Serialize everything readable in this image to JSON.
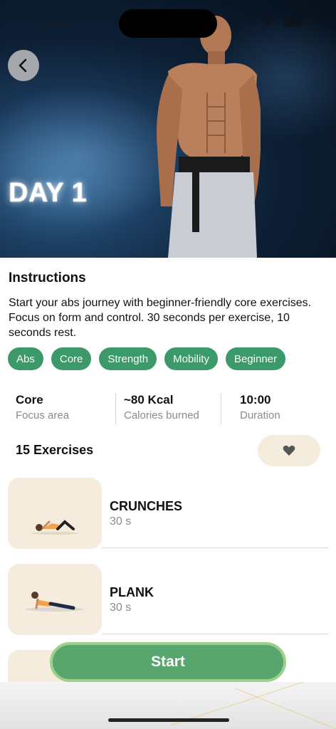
{
  "status_bar": {
    "time": "11:40"
  },
  "hero": {
    "title": "DAY 1"
  },
  "instructions": {
    "title": "Instructions",
    "text": "Start your abs journey with beginner-friendly core exercises. Focus on form and control. 30 seconds per exercise, 10 seconds rest."
  },
  "tags": [
    "Abs",
    "Core",
    "Strength",
    "Mobility",
    "Beginner"
  ],
  "stats": [
    {
      "value": "Core",
      "label": "Focus area"
    },
    {
      "value": "~80 Kcal",
      "label": "Calories burned"
    },
    {
      "value": "10:00",
      "label": "Duration"
    }
  ],
  "exercise_count": "15 Exercises",
  "exercises": [
    {
      "name": "CRUNCHES",
      "duration": "30 s"
    },
    {
      "name": "PLANK",
      "duration": "30 s"
    }
  ],
  "start_button": {
    "label": "Start"
  },
  "colors": {
    "accent_green": "#3c9a6a",
    "start_green": "#58a66e",
    "thumb_bg": "#f5ecdd"
  }
}
